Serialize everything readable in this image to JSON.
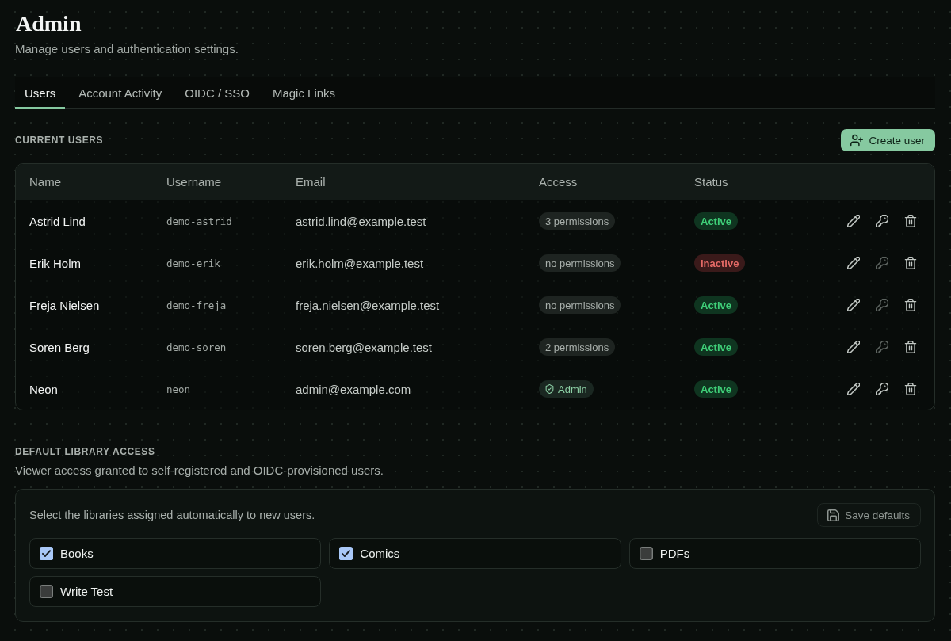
{
  "page": {
    "title": "Admin",
    "subtitle": "Manage users and authentication settings."
  },
  "tabs": [
    {
      "label": "Users",
      "selected": true
    },
    {
      "label": "Account Activity",
      "selected": false
    },
    {
      "label": "OIDC / SSO",
      "selected": false
    },
    {
      "label": "Magic Links",
      "selected": false
    }
  ],
  "current_users": {
    "heading": "CURRENT USERS",
    "create_button": {
      "label": "Create user"
    },
    "table": {
      "columns": [
        "Name",
        "Username",
        "Email",
        "Access",
        "Status"
      ],
      "rows": [
        {
          "name": "Astrid Lind",
          "username": "demo-astrid",
          "email": "astrid.lind@example.test",
          "access": {
            "kind": "permissions",
            "label": "3 permissions"
          },
          "status": {
            "kind": "active",
            "label": "Active"
          },
          "actions": [
            {
              "kind": "edit",
              "disabled": false
            },
            {
              "kind": "key",
              "disabled": false
            },
            {
              "kind": "delete",
              "disabled": false
            }
          ]
        },
        {
          "name": "Erik Holm",
          "username": "demo-erik",
          "email": "erik.holm@example.test",
          "access": {
            "kind": "permissions",
            "label": "no permissions"
          },
          "status": {
            "kind": "inactive",
            "label": "Inactive"
          },
          "actions": [
            {
              "kind": "edit",
              "disabled": false
            },
            {
              "kind": "key",
              "disabled": true
            },
            {
              "kind": "delete",
              "disabled": false
            }
          ]
        },
        {
          "name": "Freja Nielsen",
          "username": "demo-freja",
          "email": "freja.nielsen@example.test",
          "access": {
            "kind": "permissions",
            "label": "no permissions"
          },
          "status": {
            "kind": "active",
            "label": "Active"
          },
          "actions": [
            {
              "kind": "edit",
              "disabled": false
            },
            {
              "kind": "key",
              "disabled": true
            },
            {
              "kind": "delete",
              "disabled": false
            }
          ]
        },
        {
          "name": "Soren Berg",
          "username": "demo-soren",
          "email": "soren.berg@example.test",
          "access": {
            "kind": "permissions",
            "label": "2 permissions"
          },
          "status": {
            "kind": "active",
            "label": "Active"
          },
          "actions": [
            {
              "kind": "edit",
              "disabled": false
            },
            {
              "kind": "key",
              "disabled": true
            },
            {
              "kind": "delete",
              "disabled": false
            }
          ]
        },
        {
          "name": "Neon",
          "username": "neon",
          "email": "admin@example.com",
          "access": {
            "kind": "admin",
            "label": "Admin"
          },
          "status": {
            "kind": "active",
            "label": "Active"
          },
          "actions": [
            {
              "kind": "edit",
              "disabled": false
            },
            {
              "kind": "key",
              "disabled": false
            },
            {
              "kind": "delete",
              "disabled": false
            }
          ]
        }
      ]
    }
  },
  "default_library_access": {
    "heading": "DEFAULT LIBRARY ACCESS",
    "description": "Viewer access granted to self-registered and OIDC-provisioned users.",
    "instructions": "Select the libraries assigned automatically to new users.",
    "save_button": {
      "label": "Save defaults",
      "disabled": true
    },
    "libraries": [
      {
        "label": "Books",
        "checked": true
      },
      {
        "label": "Comics",
        "checked": true
      },
      {
        "label": "PDFs",
        "checked": false
      },
      {
        "label": "Write Test",
        "checked": false
      }
    ]
  }
}
